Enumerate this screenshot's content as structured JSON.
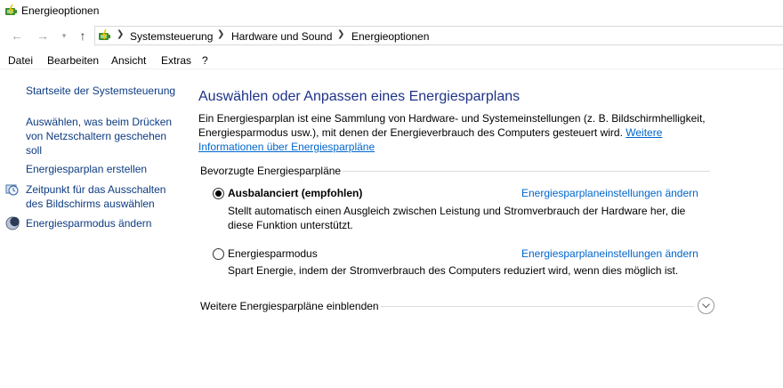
{
  "window": {
    "title": "Energieoptionen"
  },
  "nav": {
    "back_icon": "arrow-left-icon",
    "forward_icon": "arrow-right-icon",
    "recent_icon": "chevron-down-icon",
    "up_icon": "arrow-up-icon"
  },
  "breadcrumb": [
    "Systemsteuerung",
    "Hardware und Sound",
    "Energieoptionen"
  ],
  "menu": [
    "Datei",
    "Bearbeiten",
    "Ansicht",
    "Extras",
    "?"
  ],
  "sidebar": {
    "items": [
      {
        "label": "Startseite der Systemsteuerung"
      },
      {
        "label": "Auswählen, was beim Drücken\nvon Netzschaltern geschehen\nsoll"
      },
      {
        "label": "Energiesparplan erstellen"
      },
      {
        "label": "Zeitpunkt für das Ausschalten\ndes Bildschirms auswählen",
        "icon": "clock-monitor-icon"
      },
      {
        "label": "Energiesparmodus ändern",
        "icon": "moon-icon"
      }
    ]
  },
  "main": {
    "title": "Auswählen oder Anpassen eines Energiesparplans",
    "description": "Ein Energiesparplan ist eine Sammlung von Hardware- und Systemeinstellungen (z. B. Bildschirmhelligkeit, Energiesparmodus usw.), mit denen der Energieverbrauch des Computers gesteuert wird.",
    "description_link": "Weitere Informationen über Energiesparpläne",
    "group_label": "Bevorzugte Energiesparpläne",
    "plans": [
      {
        "name": "Ausbalanciert (empfohlen)",
        "selected": true,
        "link": "Energiesparplaneinstellungen ändern",
        "description": "Stellt automatisch einen Ausgleich zwischen Leistung und Stromverbrauch der Hardware her, die diese Funktion unterstützt."
      },
      {
        "name": "Energiesparmodus",
        "selected": false,
        "link": "Energiesparplaneinstellungen ändern",
        "description": "Spart Energie, indem der Stromverbrauch des Computers reduziert wird, wenn dies möglich ist."
      }
    ],
    "more_plans_label": "Weitere Energiesparpläne einblenden",
    "more_plans_icon": "chevron-down-circle-icon"
  },
  "colors": {
    "link": "#0066cc",
    "sidebar_link": "#0c3b82",
    "title": "#1e3287"
  }
}
